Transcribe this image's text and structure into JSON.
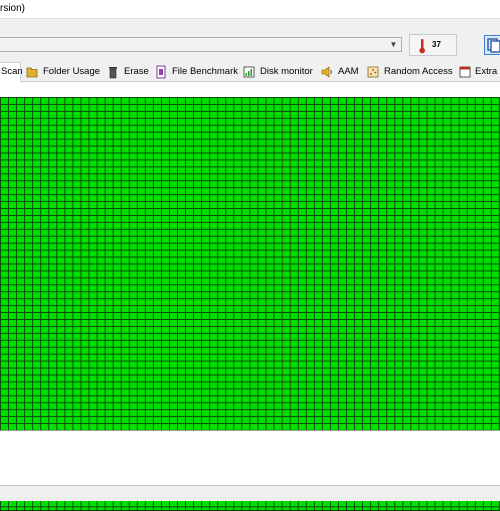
{
  "window": {
    "title": "rsion)"
  },
  "toolbar": {
    "temperature": "37",
    "drive_value": ""
  },
  "tabs": [
    {
      "label": "Scan",
      "icon": "scan-icon",
      "active": true
    },
    {
      "label": "Folder Usage",
      "icon": "folder-icon"
    },
    {
      "label": "Erase",
      "icon": "trash-icon"
    },
    {
      "label": "File Benchmark",
      "icon": "file-benchmark-icon"
    },
    {
      "label": "Disk monitor",
      "icon": "disk-monitor-icon"
    },
    {
      "label": "AAM",
      "icon": "speaker-icon"
    },
    {
      "label": "Random Access",
      "icon": "random-access-icon"
    },
    {
      "label": "Extra t",
      "icon": "extra-tests-icon"
    }
  ],
  "scan": {
    "block_status_color": "#00e000",
    "grid_line_color": "#0a4a0a",
    "progress_percent": 100
  }
}
